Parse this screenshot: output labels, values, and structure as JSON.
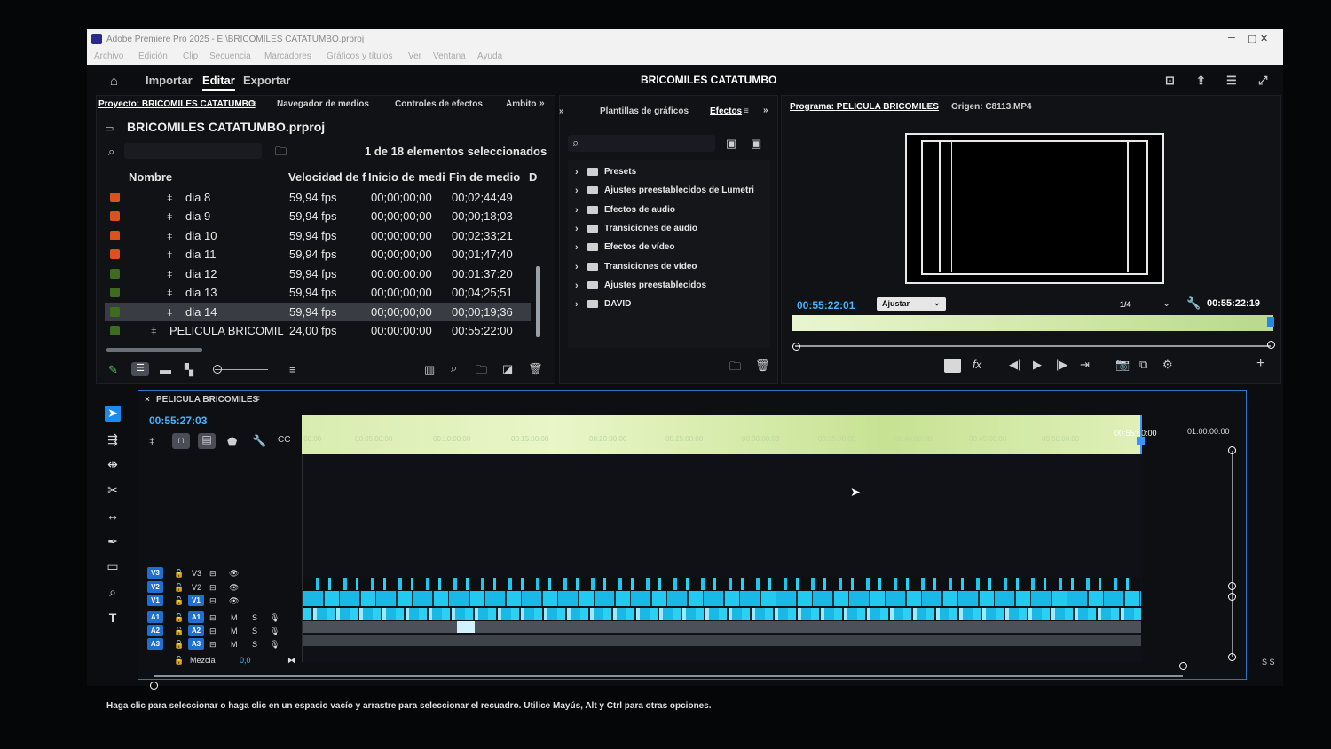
{
  "window": {
    "title": "Adobe Premiere Pro 2025 - E:\\BRICOMILES CATATUMBO.prproj",
    "logo": "Pr"
  },
  "menu": [
    "Archivo",
    "Edición",
    "Clip",
    "Secuencia",
    "Marcadores",
    "Gráficos y títulos",
    "Ver",
    "Ventana",
    "Ayuda"
  ],
  "topnav": {
    "import": "Importar",
    "edit": "Editar",
    "export": "Exportar",
    "project_title": "BRICOMILES CATATUMBO"
  },
  "project_panel": {
    "tab_project": "Proyecto: BRICOMILES CATATUMBO",
    "tab_media": "Navegador de medios",
    "tab_effect_controls": "Controles de efectos",
    "tab_scope": "Ámbito",
    "file": "BRICOMILES CATATUMBO.prproj",
    "selection": "1 de 18 elementos seleccionados",
    "headers": {
      "name": "Nombre",
      "fps": "Velocidad de f",
      "start": "Inicio de medi",
      "end": "Fin de medio",
      "extra": "D"
    },
    "rows": [
      {
        "name": "dia 8",
        "fps": "59,94 fps",
        "start": "00;00;00;00",
        "end": "00;02;44;49",
        "color": "#d9531e"
      },
      {
        "name": "dia 9",
        "fps": "59,94 fps",
        "start": "00;00;00;00",
        "end": "00;00;18;03",
        "color": "#d9531e"
      },
      {
        "name": "dia 10",
        "fps": "59,94 fps",
        "start": "00;00;00;00",
        "end": "00;02;33;21",
        "color": "#d9531e"
      },
      {
        "name": "dia 11",
        "fps": "59,94 fps",
        "start": "00;00;00;00",
        "end": "00;01;47;40",
        "color": "#d9531e"
      },
      {
        "name": "dia 12",
        "fps": "59,94 fps",
        "start": "00:00:00:00",
        "end": "00:01:37:20",
        "color": "#3d6b1f"
      },
      {
        "name": "dia 13",
        "fps": "59,94 fps",
        "start": "00;00;00;00",
        "end": "00;04;25;51",
        "color": "#3d6b1f"
      },
      {
        "name": "dia 14",
        "fps": "59,94 fps",
        "start": "00;00;00;00",
        "end": "00;00;19;36",
        "color": "#3d6b1f"
      },
      {
        "name": "PELICULA BRICOMIL",
        "fps": "24,00 fps",
        "start": "00:00:00:00",
        "end": "00:55:22:00",
        "color": "#3d6b1f"
      }
    ]
  },
  "effects_panel": {
    "tab_graphics": "Plantillas de gráficos",
    "tab_effects": "Efectos",
    "items": [
      "Presets",
      "Ajustes preestablecidos de Lumetri",
      "Efectos de audio",
      "Transiciones de audio",
      "Efectos de vídeo",
      "Transiciones de vídeo",
      "Ajustes preestablecidos",
      "DAVID"
    ]
  },
  "program_monitor": {
    "tab_program": "Programa: PELICULA BRICOMILES",
    "tab_source": "Origen: C8113.MP4",
    "timecode": "00:55:22:01",
    "fit": "Ajustar",
    "resolution": "1/4",
    "duration": "00:55:22:19"
  },
  "timeline": {
    "sequence": "PELICULA BRICOMILES",
    "timecode": "00:55:27:03",
    "ruler": [
      ":00:00",
      "00:05:00:00",
      "00:10:00:00",
      "00:15:00:00",
      "00:20:00:00",
      "00:25:00:00",
      "00:30:00:00",
      "00:35:00:00",
      "00:40:00:00",
      "00:45:00:00",
      "00:50:00:00",
      "00:55:00:00",
      "01:00:00:00"
    ],
    "video_tracks": [
      "V3",
      "V2",
      "V1"
    ],
    "audio_tracks": [
      "A1",
      "A2",
      "A3"
    ],
    "mix_label": "Mezcla",
    "mix_value": "0,0",
    "ms": {
      "m": "M",
      "s": "S"
    },
    "meter_label": "S S"
  },
  "status": "Haga clic para seleccionar o haga clic en un espacio vacío y arrastre para seleccionar el recuadro. Utilice Mayús, Alt y Ctrl para otras opciones."
}
